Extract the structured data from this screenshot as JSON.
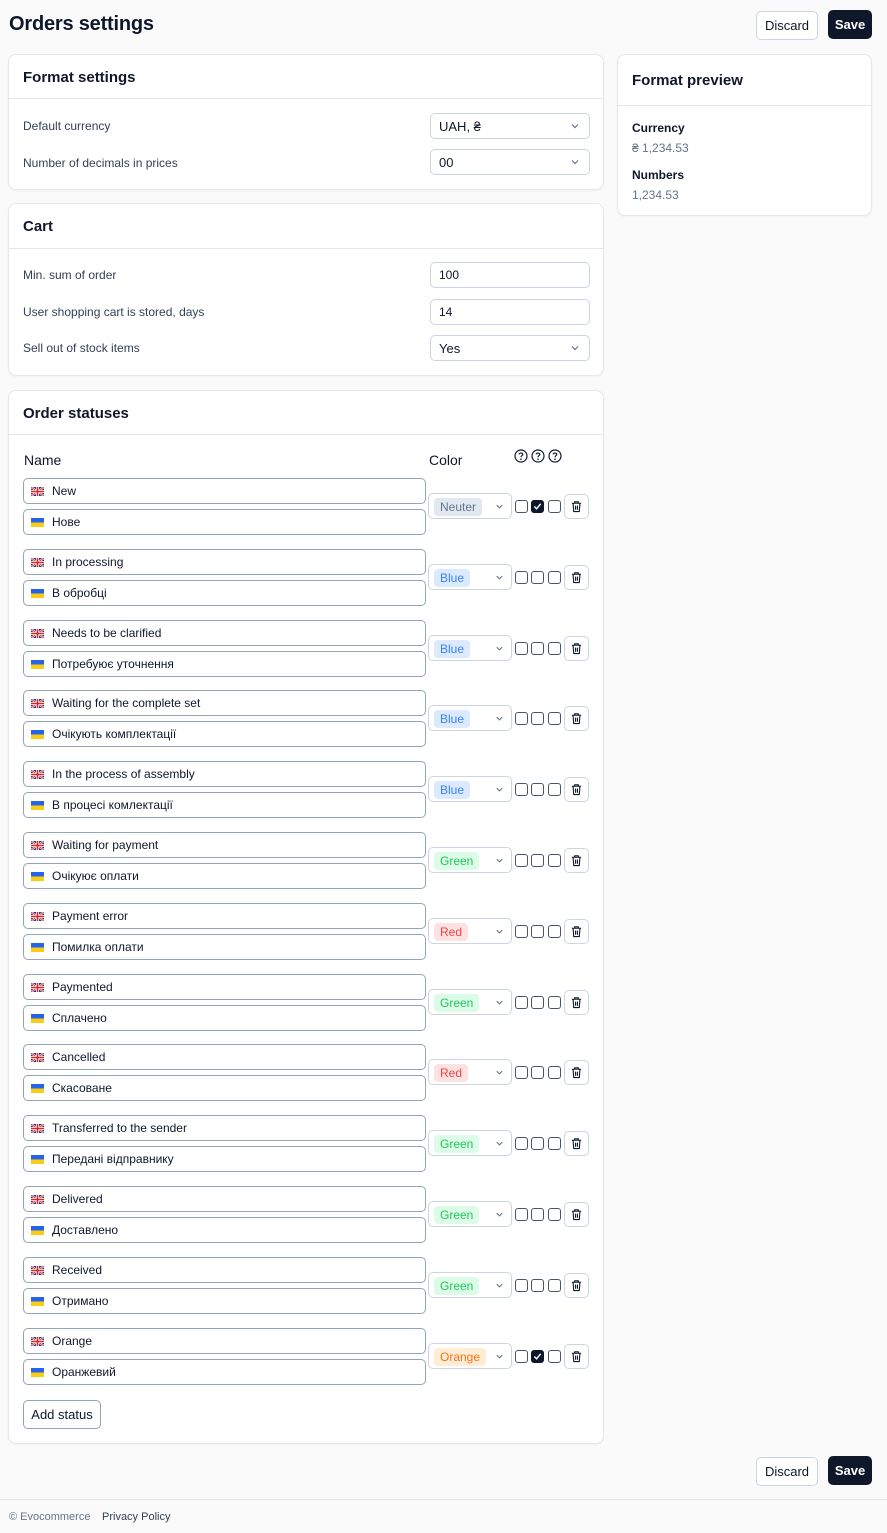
{
  "header": {
    "title": "Orders settings",
    "discard_label": "Discard",
    "save_label": "Save"
  },
  "format_settings": {
    "title": "Format settings",
    "currency_label": "Default currency",
    "currency_value": "UAH, ₴",
    "decimals_label": "Number of decimals in prices",
    "decimals_value": "00"
  },
  "cart": {
    "title": "Cart",
    "min_sum_label": "Min. sum of order",
    "min_sum_value": "100",
    "stored_days_label": "User shopping cart is stored, days",
    "stored_days_value": "14",
    "sell_out_label": "Sell out of stock items",
    "sell_out_value": "Yes"
  },
  "preview": {
    "title": "Format preview",
    "currency_label": "Currency",
    "currency_value": "₴ 1,234.53",
    "numbers_label": "Numbers",
    "numbers_value": "1,234.53"
  },
  "order_statuses": {
    "title": "Order statuses",
    "name_header": "Name",
    "color_header": "Color",
    "add_label": "Add status",
    "items": [
      {
        "en": "New",
        "uk": "Нове",
        "color": "Neuter",
        "checks": [
          false,
          true,
          false
        ]
      },
      {
        "en": "In processing",
        "uk": "В обробці",
        "color": "Blue",
        "checks": [
          false,
          false,
          false
        ]
      },
      {
        "en": "Needs to be clarified",
        "uk": "Потребуює уточнення",
        "color": "Blue",
        "checks": [
          false,
          false,
          false
        ]
      },
      {
        "en": "Waiting for the complete set",
        "uk": "Очікують комплектації",
        "color": "Blue",
        "checks": [
          false,
          false,
          false
        ]
      },
      {
        "en": "In the process of assembly",
        "uk": "В процесі комлектації",
        "color": "Blue",
        "checks": [
          false,
          false,
          false
        ]
      },
      {
        "en": "Waiting for payment",
        "uk": "Очікуює оплати",
        "color": "Green",
        "checks": [
          false,
          false,
          false
        ]
      },
      {
        "en": "Payment error",
        "uk": "Помилка оплати",
        "color": "Red",
        "checks": [
          false,
          false,
          false
        ]
      },
      {
        "en": "Paymented",
        "uk": "Сплачено",
        "color": "Green",
        "checks": [
          false,
          false,
          false
        ]
      },
      {
        "en": "Cancelled",
        "uk": "Скасоване",
        "color": "Red",
        "checks": [
          false,
          false,
          false
        ]
      },
      {
        "en": "Transferred to the sender",
        "uk": "Передані відправнику",
        "color": "Green",
        "checks": [
          false,
          false,
          false
        ]
      },
      {
        "en": "Delivered",
        "uk": "Доставлено",
        "color": "Green",
        "checks": [
          false,
          false,
          false
        ]
      },
      {
        "en": "Received",
        "uk": "Отримано",
        "color": "Green",
        "checks": [
          false,
          false,
          false
        ]
      },
      {
        "en": "Orange",
        "uk": "Оранжевий",
        "color": "Orange",
        "checks": [
          false,
          true,
          false
        ]
      }
    ]
  },
  "badge_colors": {
    "Neuter": {
      "bg": "#e2e8f0",
      "fg": "#64748b"
    },
    "Blue": {
      "bg": "#dbeafe",
      "fg": "#3b82f6"
    },
    "Green": {
      "bg": "#dcfce7",
      "fg": "#22c55e"
    },
    "Red": {
      "bg": "#fee2e2",
      "fg": "#ef4444"
    },
    "Orange": {
      "bg": "#ffedd5",
      "fg": "#f97316"
    }
  },
  "footer": {
    "copyright": "© Evocommerce",
    "privacy": "Privacy Policy"
  }
}
